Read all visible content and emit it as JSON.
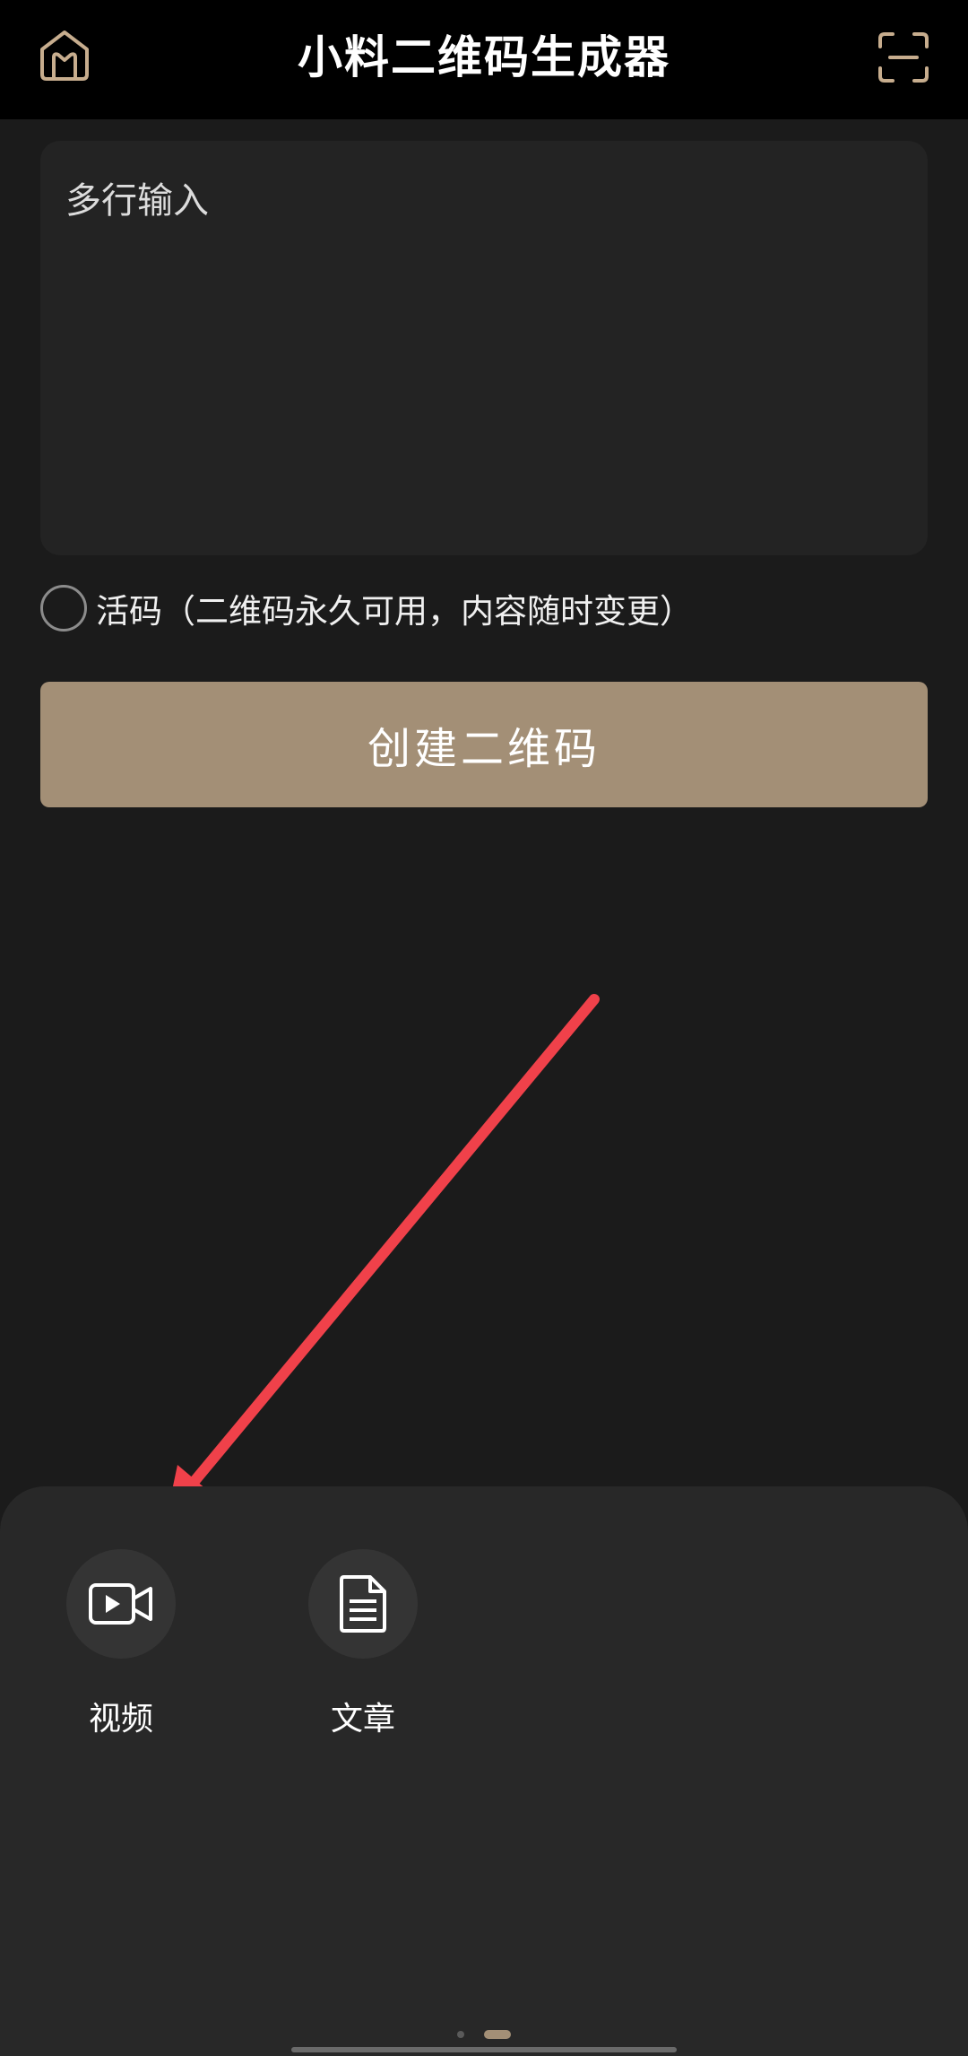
{
  "header": {
    "title": "小料二维码生成器",
    "home_icon": "home-logo-icon",
    "scan_icon": "scan-icon"
  },
  "input": {
    "placeholder": "多行输入",
    "value": ""
  },
  "live_code": {
    "label": "活码（二维码永久可用，内容随时变更）",
    "checked": false
  },
  "create_button": {
    "label": "创建二维码"
  },
  "bottom_sheet": {
    "items": [
      {
        "label": "视频",
        "icon": "video-icon"
      },
      {
        "label": "文章",
        "icon": "document-icon"
      }
    ],
    "page_indicator": {
      "pages": 2,
      "active": 2
    }
  },
  "colors": {
    "accent": "#a38f76",
    "background": "#1b1b1b",
    "header": "#000000",
    "annotation_arrow": "#f0414a"
  }
}
